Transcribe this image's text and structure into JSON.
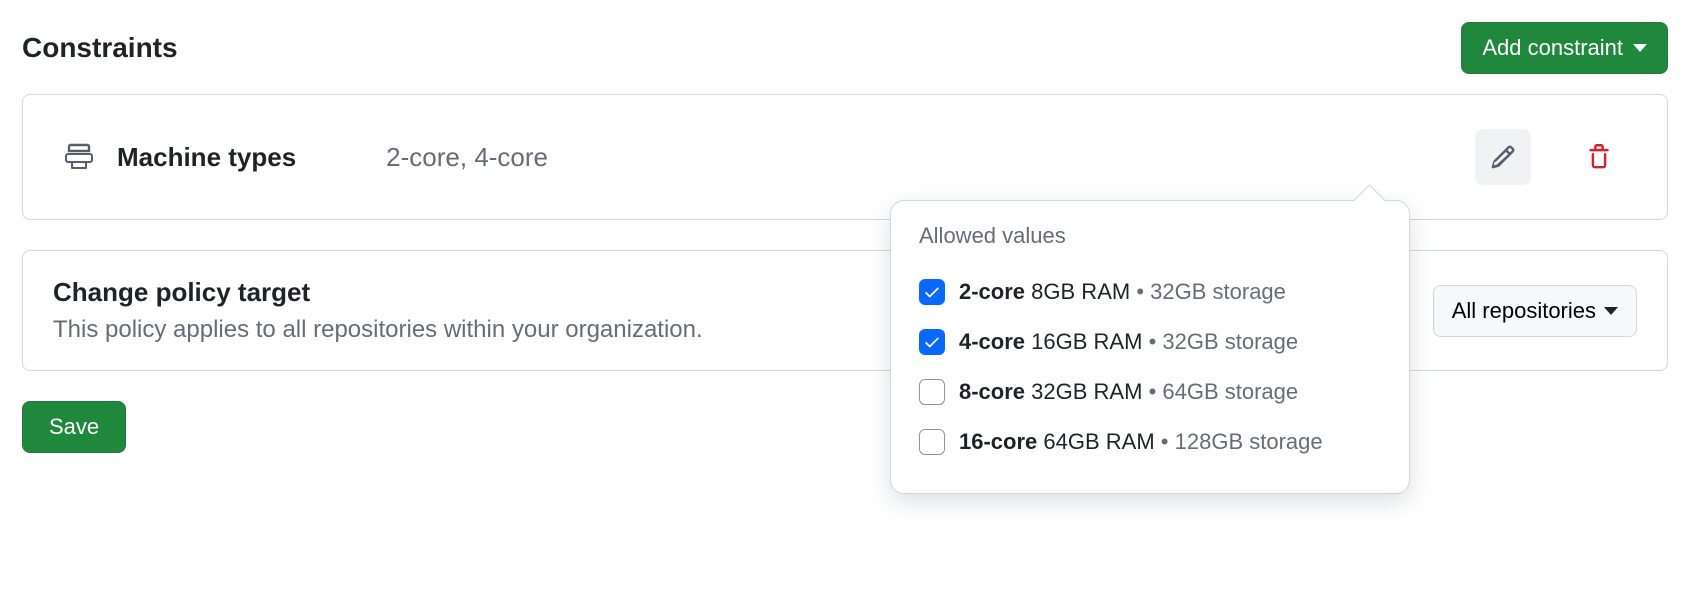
{
  "section_title": "Constraints",
  "add_constraint_label": "Add constraint",
  "constraint": {
    "name": "Machine types",
    "summary": "2-core, 4-core"
  },
  "popover": {
    "title": "Allowed values",
    "options": [
      {
        "core": "2-core",
        "specs": "8GB RAM",
        "storage": "32GB storage",
        "checked": true
      },
      {
        "core": "4-core",
        "specs": "16GB RAM",
        "storage": "32GB storage",
        "checked": true
      },
      {
        "core": "8-core",
        "specs": "32GB RAM",
        "storage": "64GB storage",
        "checked": false
      },
      {
        "core": "16-core",
        "specs": "64GB RAM",
        "storage": "128GB storage",
        "checked": false
      }
    ]
  },
  "target": {
    "title": "Change policy target",
    "desc": "This policy applies to all repositories within your organization.",
    "select_label": "All repositories"
  },
  "save_label": "Save"
}
